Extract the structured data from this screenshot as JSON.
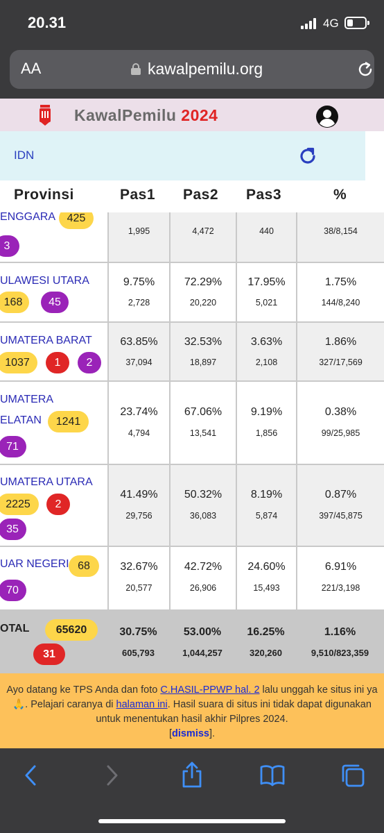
{
  "status_bar": {
    "time": "20.31",
    "network": "4G"
  },
  "browser": {
    "aa_label": "AA",
    "url": "kawalpemilu.org"
  },
  "site": {
    "title": "KawalPemilu",
    "year": "2024",
    "region": "IDN"
  },
  "table": {
    "headers": [
      "Provinsi",
      "Pas1",
      "Pas2",
      "Pas3",
      "%"
    ],
    "rows": [
      {
        "province": "ENGGARA",
        "badges": [
          "425",
          "3"
        ],
        "pas1": "",
        "pas2": "",
        "pas3": "",
        "pct": "",
        "pas1_count": "1,995",
        "pas2_count": "4,472",
        "pas3_count": "440",
        "pct_count": "38/8,154"
      },
      {
        "province": "ULAWESI UTARA",
        "badges": [
          "168",
          "45"
        ],
        "pas1": "9.75%",
        "pas2": "72.29%",
        "pas3": "17.95%",
        "pct": "1.75%",
        "pas1_count": "2,728",
        "pas2_count": "20,220",
        "pas3_count": "5,021",
        "pct_count": "144/8,240"
      },
      {
        "province": "UMATERA BARAT",
        "badges": [
          "1037",
          "1",
          "2"
        ],
        "pas1": "63.85%",
        "pas2": "32.53%",
        "pas3": "3.63%",
        "pct": "1.86%",
        "pas1_count": "37,094",
        "pas2_count": "18,897",
        "pas3_count": "2,108",
        "pct_count": "327/17,569"
      },
      {
        "province_line1": "UMATERA",
        "province_line2": "ELATAN",
        "badges": [
          "1241",
          "71"
        ],
        "pas1": "23.74%",
        "pas2": "67.06%",
        "pas3": "9.19%",
        "pct": "0.38%",
        "pas1_count": "4,794",
        "pas2_count": "13,541",
        "pas3_count": "1,856",
        "pct_count": "99/25,985"
      },
      {
        "province": "UMATERA UTARA",
        "badges": [
          "2225",
          "2",
          "35"
        ],
        "pas1": "41.49%",
        "pas2": "50.32%",
        "pas3": "8.19%",
        "pct": "0.87%",
        "pas1_count": "29,756",
        "pas2_count": "36,083",
        "pas3_count": "5,874",
        "pct_count": "397/45,875"
      },
      {
        "province": "UAR NEGERI",
        "badges": [
          "68",
          "70"
        ],
        "pas1": "32.67%",
        "pas2": "42.72%",
        "pas3": "24.60%",
        "pct": "6.91%",
        "pas1_count": "20,577",
        "pas2_count": "26,906",
        "pas3_count": "15,493",
        "pct_count": "221/3,198"
      }
    ],
    "total": {
      "label": "OTAL",
      "badges": [
        "65620",
        "31"
      ],
      "pas1": "30.75%",
      "pas2": "53.00%",
      "pas3": "16.25%",
      "pct": "1.16%",
      "pas1_count": "605,793",
      "pas2_count": "1,044,257",
      "pas3_count": "320,260",
      "pct_count": "9,510/823,359"
    }
  },
  "notice": {
    "text1": "Ayo datang ke TPS Anda dan foto ",
    "link1": "C.HASIL-PPWP hal. 2",
    "text2": " lalu unggah ke situs ini ya 🙏. Pelajari caranya di ",
    "link2": "halaman ini",
    "text3": ". Hasil suara di situs ini tidak dapat digunakan untuk menentukan hasil akhir Pilpres 2024.",
    "bracket_open": "[",
    "dismiss": "dismiss",
    "bracket_close": "]."
  },
  "colors": {
    "badge_yellow": "#fdd64a",
    "badge_red": "#e02626",
    "badge_purple": "#9a23b8",
    "link_blue": "#2a2ab5",
    "year_red": "#e02424",
    "notice_bg": "#fdc15a"
  },
  "icons": [
    "lock-icon",
    "reload-icon",
    "account-icon",
    "refresh-icon",
    "back-icon",
    "forward-icon",
    "share-icon",
    "bookmarks-icon",
    "tabs-icon"
  ]
}
